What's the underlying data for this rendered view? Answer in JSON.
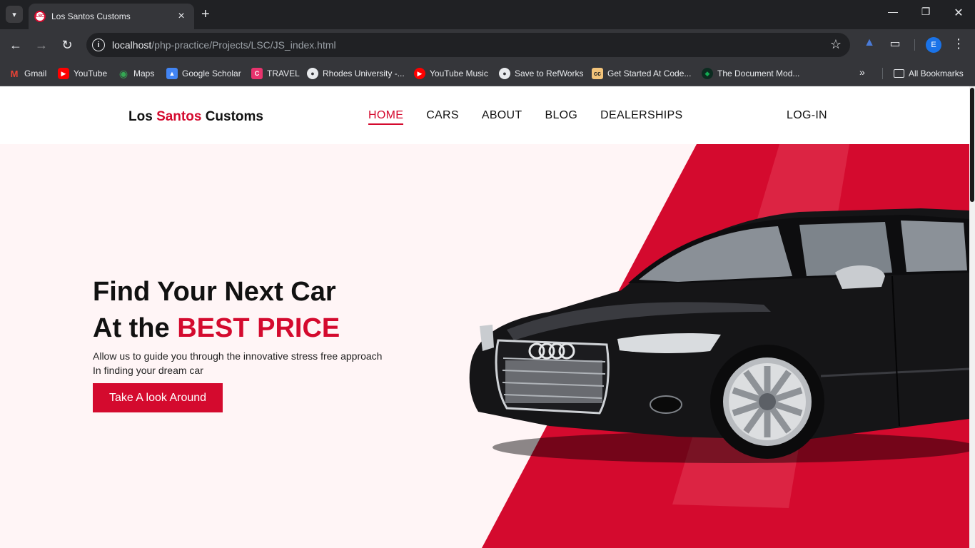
{
  "browser": {
    "tab_title": "Los Santos Customs",
    "tab_favicon_text": "LSC",
    "url_host": "localhost",
    "url_path": "/php-practice/Projects/LSC/JS_index.html",
    "profile_initial": "E",
    "bookmarks": [
      {
        "label": "Gmail",
        "icon": "gmail-icon",
        "color": "#ea4335"
      },
      {
        "label": "YouTube",
        "icon": "youtube-icon",
        "color": "#ff0000"
      },
      {
        "label": "Maps",
        "icon": "maps-icon",
        "color": "#34a853"
      },
      {
        "label": "Google Scholar",
        "icon": "scholar-icon",
        "color": "#4285f4"
      },
      {
        "label": "TRAVEL",
        "icon": "travel-icon",
        "color": "#e8336d"
      },
      {
        "label": "Rhodes University -...",
        "icon": "globe-icon",
        "color": "#e8eaed"
      },
      {
        "label": "YouTube Music",
        "icon": "youtube-music-icon",
        "color": "#ff0000"
      },
      {
        "label": "Save to RefWorks",
        "icon": "globe-icon",
        "color": "#e8eaed"
      },
      {
        "label": "Get Started At Code...",
        "icon": "codecademy-icon",
        "color": "#f3c47a"
      },
      {
        "label": "The Document Mod...",
        "icon": "mongodb-icon",
        "color": "#13aa52"
      }
    ],
    "all_bookmarks_label": "All Bookmarks"
  },
  "site": {
    "logo_part1": "Los ",
    "logo_accent": "Santos",
    "logo_part2": " Customs",
    "nav": [
      {
        "label": "HOME",
        "active": true
      },
      {
        "label": "CARS",
        "active": false
      },
      {
        "label": "ABOUT",
        "active": false
      },
      {
        "label": "BLOG",
        "active": false
      },
      {
        "label": "DEALERSHIPS",
        "active": false
      }
    ],
    "login_label": "LOG-IN"
  },
  "hero": {
    "headline_line1": "Find Your Next Car",
    "headline_line2_prefix": "At the ",
    "headline_line2_accent": "BEST PRICE",
    "subtext_line1": "Allow us to guide you through the innovative stress free approach",
    "subtext_line2": "In finding your dream car",
    "cta_label": "Take A look Around"
  },
  "colors": {
    "accent": "#d40a2e",
    "hero_bg": "#fff5f6",
    "chrome_dark": "#202124",
    "chrome_toolbar": "#35363a"
  }
}
